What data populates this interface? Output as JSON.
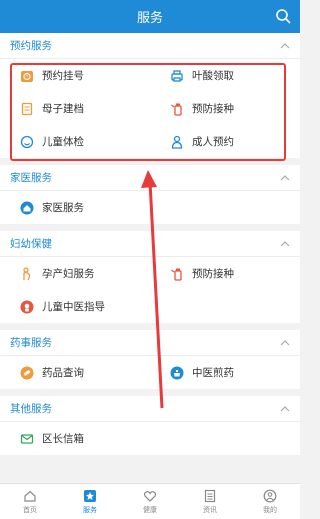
{
  "header": {
    "title": "服务"
  },
  "sections": [
    {
      "title": "预约服务",
      "items": [
        {
          "label": "预约挂号",
          "icon": "clock-card-icon"
        },
        {
          "label": "叶酸领取",
          "icon": "printer-icon"
        },
        {
          "label": "母子建档",
          "icon": "document-icon"
        },
        {
          "label": "预防接种",
          "icon": "vaccine-bottle-icon"
        },
        {
          "label": "儿童体检",
          "icon": "child-face-icon"
        },
        {
          "label": "成人预约",
          "icon": "adult-person-icon"
        }
      ]
    },
    {
      "title": "家医服务",
      "items": [
        {
          "label": "家医服务",
          "icon": "home-doctor-icon"
        }
      ]
    },
    {
      "title": "妇幼保健",
      "items": [
        {
          "label": "孕产妇服务",
          "icon": "pregnant-woman-icon"
        },
        {
          "label": "预防接种",
          "icon": "vaccine-bottle-icon"
        },
        {
          "label": "儿童中医指导",
          "icon": "child-tcm-icon"
        }
      ]
    },
    {
      "title": "药事服务",
      "items": [
        {
          "label": "药品查询",
          "icon": "pill-icon"
        },
        {
          "label": "中医煎药",
          "icon": "herbal-pot-icon"
        }
      ]
    },
    {
      "title": "其他服务",
      "items": [
        {
          "label": "区长信箱",
          "icon": "mail-icon"
        }
      ]
    }
  ],
  "tabbar": [
    {
      "label": "首页",
      "icon": "home-icon",
      "active": false
    },
    {
      "label": "服务",
      "icon": "star-icon",
      "active": true
    },
    {
      "label": "健康",
      "icon": "heart-icon",
      "active": false
    },
    {
      "label": "资讯",
      "icon": "news-icon",
      "active": false
    },
    {
      "label": "我的",
      "icon": "profile-icon",
      "active": false
    }
  ],
  "colors": {
    "brand": "#1f8ad6",
    "orange": "#f29a3a",
    "red": "#e83a3a"
  }
}
